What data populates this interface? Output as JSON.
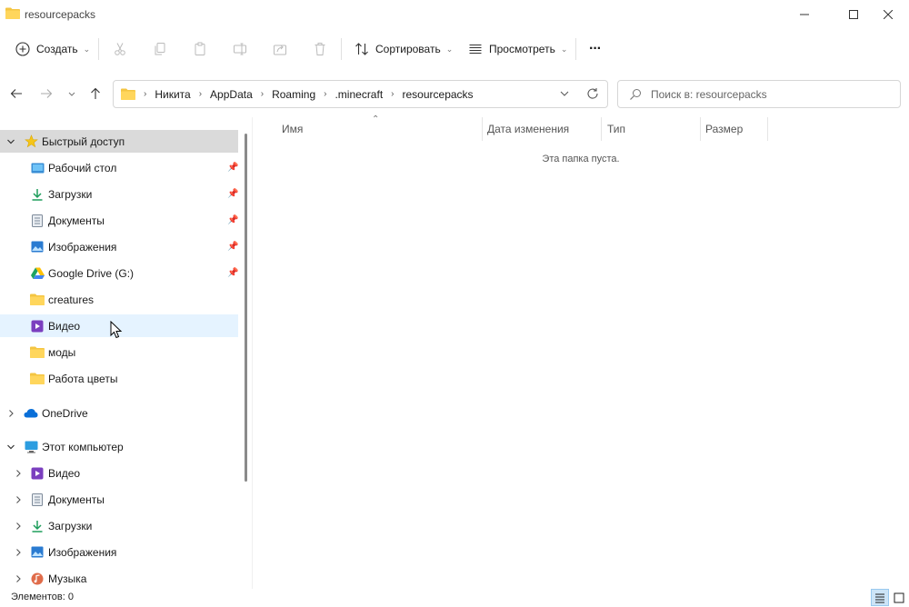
{
  "window": {
    "title": "resourcepacks"
  },
  "toolbar": {
    "create_label": "Создать",
    "sort_label": "Сортировать",
    "view_label": "Просмотреть",
    "more_label": "···"
  },
  "address": {
    "crumbs": [
      "Никита",
      "AppData",
      "Roaming",
      ".minecraft",
      "resourcepacks"
    ]
  },
  "search": {
    "placeholder": "Поиск в: resourcepacks"
  },
  "sidebar": {
    "quick_access": "Быстрый доступ",
    "items": [
      {
        "label": "Рабочий стол",
        "icon": "desktop-icon",
        "pinned": true
      },
      {
        "label": "Загрузки",
        "icon": "downloads-icon",
        "pinned": true
      },
      {
        "label": "Документы",
        "icon": "documents-icon",
        "pinned": true
      },
      {
        "label": "Изображения",
        "icon": "pictures-icon",
        "pinned": true
      },
      {
        "label": "Google Drive (G:)",
        "icon": "google-drive-icon",
        "pinned": true
      },
      {
        "label": "creatures",
        "icon": "folder-icon",
        "pinned": false
      },
      {
        "label": "Видео",
        "icon": "videos-icon",
        "pinned": false
      },
      {
        "label": "моды",
        "icon": "folder-icon",
        "pinned": false
      },
      {
        "label": "Работа цветы",
        "icon": "folder-icon",
        "pinned": false
      }
    ],
    "onedrive": "OneDrive",
    "this_pc": "Этот компьютер",
    "pc_items": [
      {
        "label": "Видео",
        "icon": "videos-icon"
      },
      {
        "label": "Документы",
        "icon": "documents-icon"
      },
      {
        "label": "Загрузки",
        "icon": "downloads-icon"
      },
      {
        "label": "Изображения",
        "icon": "pictures-icon"
      },
      {
        "label": "Музыка",
        "icon": "music-icon"
      }
    ]
  },
  "columns": [
    "Имя",
    "Дата изменения",
    "Тип",
    "Размер"
  ],
  "content": {
    "empty_message": "Эта папка пуста."
  },
  "status": {
    "items_text": "Элементов: 0"
  },
  "colors": {
    "folder": "#f4c542",
    "accent": "#0067c0",
    "selected": "#dadada",
    "hover": "#e5f3ff"
  }
}
